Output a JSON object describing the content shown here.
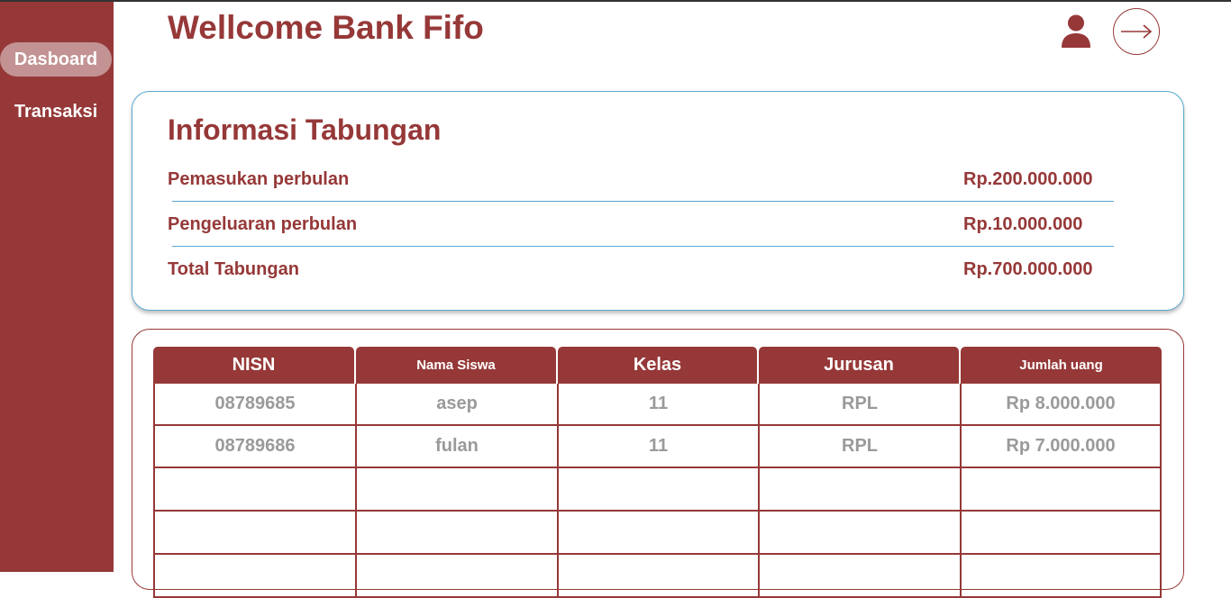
{
  "sidebar": {
    "items": [
      {
        "label": "Dasboard",
        "active": true
      },
      {
        "label": "Transaksi",
        "active": false
      }
    ]
  },
  "header": {
    "title": "Wellcome Bank Fifo",
    "user_icon": "user-icon",
    "logout_icon": "arrow-right-icon"
  },
  "info": {
    "title": "Informasi Tabungan",
    "rows": [
      {
        "label": "Pemasukan perbulan",
        "value": "Rp.200.000.000"
      },
      {
        "label": "Pengeluaran perbulan",
        "value": "Rp.10.000.000"
      },
      {
        "label": "Total Tabungan",
        "value": "Rp.700.000.000"
      }
    ]
  },
  "table": {
    "columns": [
      "NISN",
      "Nama Siswa",
      "Kelas",
      "Jurusan",
      "Jumlah uang"
    ],
    "rows": [
      [
        "08789685",
        "asep",
        "11",
        "RPL",
        "Rp 8.000.000"
      ],
      [
        "08789686",
        "fulan",
        "11",
        "RPL",
        "Rp 7.000.000"
      ],
      [
        "",
        "",
        "",
        "",
        ""
      ],
      [
        "",
        "",
        "",
        "",
        ""
      ],
      [
        "",
        "",
        "",
        "",
        ""
      ]
    ]
  },
  "colors": {
    "primary": "#963838",
    "active_nav": "#c39393",
    "accent_border": "#5aa9d0",
    "cell_text": "#9a9a9a"
  }
}
